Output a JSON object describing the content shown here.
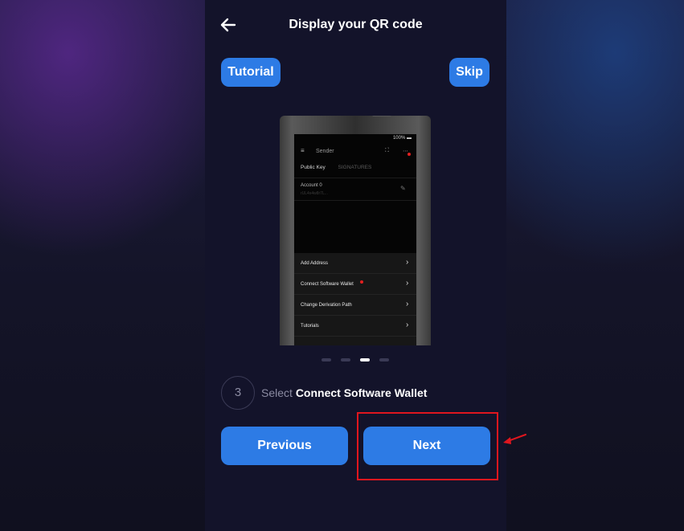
{
  "header": {
    "title": "Display your QR code"
  },
  "buttons": {
    "tutorial": "Tutorial",
    "skip": "Skip",
    "previous": "Previous",
    "next": "Next"
  },
  "device_screen": {
    "battery": "100%",
    "title": "Sender",
    "tabs": [
      "Public Key",
      "SIGNATURES"
    ],
    "account_name": "Account 0",
    "account_address": "rUL4s4w8r7L..."
  },
  "sheet_items": [
    "Add Address",
    "Connect Software Wallet",
    "Change Derivation Path",
    "Tutorials"
  ],
  "pager": {
    "total": 4,
    "active_index": 2
  },
  "step": {
    "number": "3",
    "prefix": "Select",
    "emphasis": "Connect Software Wallet"
  },
  "colors": {
    "accent": "#2d7be5",
    "highlight": "#e0161e",
    "panel": "#13132a"
  }
}
